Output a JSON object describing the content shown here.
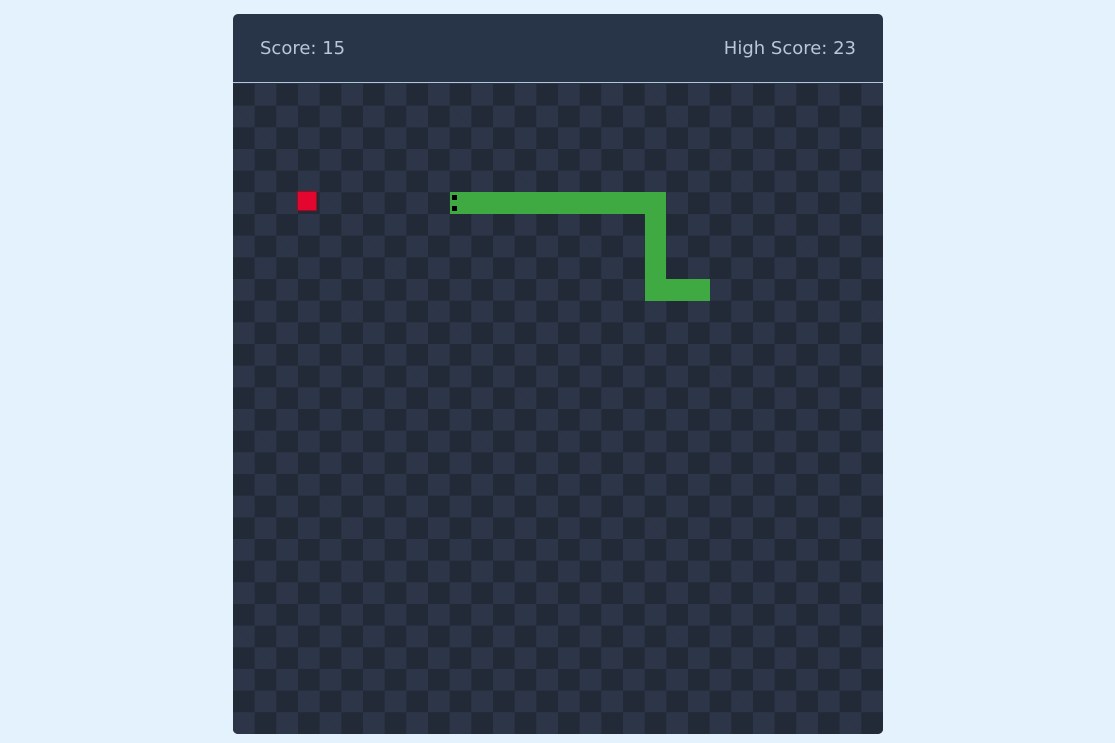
{
  "header": {
    "score_text": "Score: 15",
    "high_score_text": "High Score: 23"
  },
  "game": {
    "grid_columns": 30,
    "grid_rows": 30,
    "food": {
      "col": 3,
      "row": 5
    },
    "snake": [
      {
        "col": 11,
        "row": 6
      },
      {
        "col": 12,
        "row": 6
      },
      {
        "col": 13,
        "row": 6
      },
      {
        "col": 14,
        "row": 6
      },
      {
        "col": 15,
        "row": 6
      },
      {
        "col": 16,
        "row": 6
      },
      {
        "col": 17,
        "row": 6
      },
      {
        "col": 19,
        "row": 6
      },
      {
        "col": 20,
        "row": 6
      },
      {
        "col": 20,
        "row": 7
      },
      {
        "col": 20,
        "row": 8
      },
      {
        "col": 20,
        "row": 9
      },
      {
        "col": 21,
        "row": 10
      },
      {
        "col": 22,
        "row": 10
      }
    ],
    "heading": "left",
    "colors": {
      "snake": "#3EAA41",
      "food": "#E3072F",
      "board_dark": "#222A38",
      "board_light": "#2D3649",
      "panel": "#283447",
      "text": "#B8C6DC",
      "page_background": "#E3F2FD"
    }
  }
}
